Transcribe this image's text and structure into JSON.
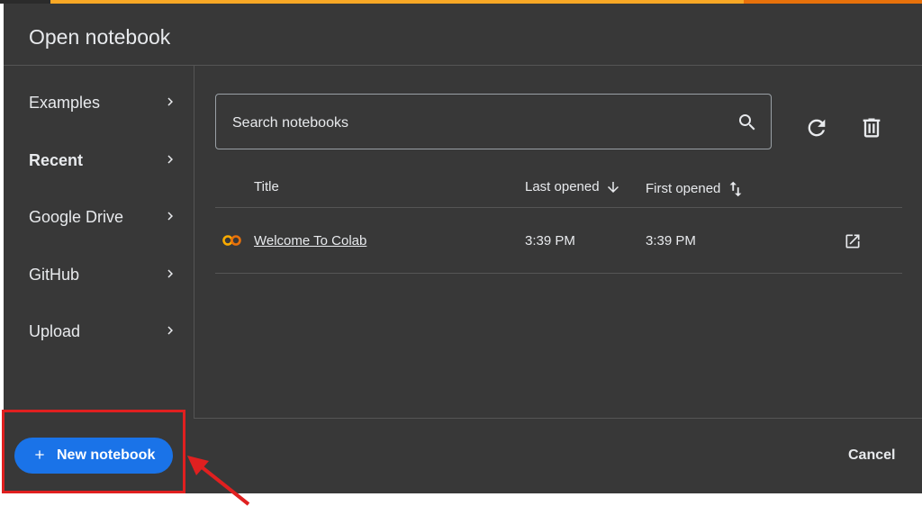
{
  "dialog": {
    "title": "Open notebook"
  },
  "sidebar": {
    "items": [
      {
        "label": "Examples",
        "selected": false
      },
      {
        "label": "Recent",
        "selected": true
      },
      {
        "label": "Google Drive",
        "selected": false
      },
      {
        "label": "GitHub",
        "selected": false
      },
      {
        "label": "Upload",
        "selected": false
      }
    ]
  },
  "search": {
    "placeholder": "Search notebooks"
  },
  "table": {
    "columns": [
      "Title",
      "Last opened",
      "First opened"
    ],
    "rows": [
      {
        "title": "Welcome To Colab",
        "last_opened": "3:39 PM",
        "first_opened": "3:39 PM"
      }
    ]
  },
  "footer": {
    "new_notebook_label": "New notebook",
    "cancel_label": "Cancel"
  },
  "colors": {
    "dialog_bg": "#383838",
    "accent_blue": "#1a73e8",
    "colab_orange": "#f9ab00",
    "annotation_red": "#e02020"
  },
  "icons": [
    "search-icon",
    "refresh-icon",
    "trash-icon",
    "sort-down-icon",
    "sort-both-icon",
    "colab-logo-icon",
    "open-in-new-icon",
    "plus-icon",
    "chevron-right-icon"
  ]
}
